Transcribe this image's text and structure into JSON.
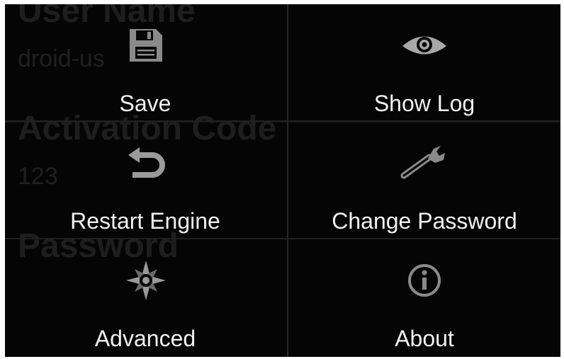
{
  "background_form": {
    "user_name_label": "User Name",
    "user_name_value": "droid-us",
    "activation_code_label": "Activation Code",
    "activation_code_value": "123",
    "password_label": "Password"
  },
  "menu": {
    "items": [
      {
        "label": "Save",
        "icon": "floppy-disk-icon"
      },
      {
        "label": "Show Log",
        "icon": "eye-icon"
      },
      {
        "label": "Restart Engine",
        "icon": "undo-arrow-icon"
      },
      {
        "label": "Change Password",
        "icon": "wrench-icon"
      },
      {
        "label": "Advanced",
        "icon": "compass-star-icon"
      },
      {
        "label": "About",
        "icon": "info-icon"
      }
    ]
  },
  "colors": {
    "menu_background": "#050505",
    "menu_text": "#f2f2f2",
    "icon_gray": "#8a8a8a",
    "faded_form_text": "#242424"
  }
}
